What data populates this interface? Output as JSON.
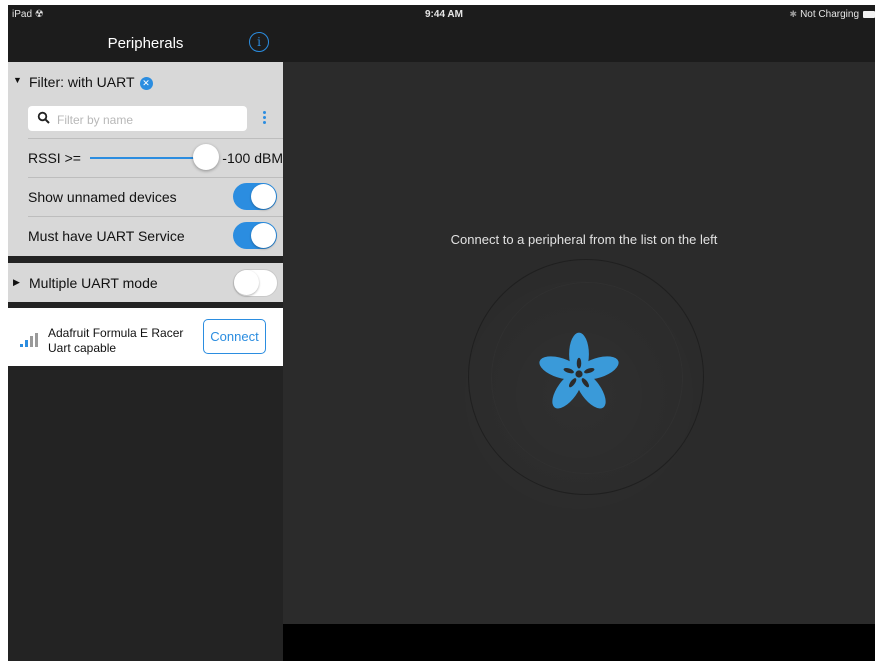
{
  "status_bar": {
    "device": "iPad",
    "time": "9:44 AM",
    "charging": "Not Charging"
  },
  "sidebar": {
    "title": "Peripherals",
    "filter": {
      "title": "Filter: with UART",
      "search_placeholder": "Filter by name",
      "search_value": "",
      "rssi_label": "RSSI >=",
      "rssi_value": "-100 dBM",
      "rssi_level": 1.0,
      "show_unnamed_label": "Show unnamed devices",
      "show_unnamed_on": true,
      "must_have_uart_label": "Must have UART Service",
      "must_have_uart_on": true
    },
    "multiple_uart": {
      "label": "Multiple UART mode",
      "on": false
    },
    "devices": [
      {
        "name": "Adafruit Formula E Racer",
        "subtitle": "Uart capable",
        "action": "Connect"
      }
    ]
  },
  "detail": {
    "message": "Connect to a peripheral from the list on the left"
  },
  "colors": {
    "accent": "#2b8de0",
    "background": "#2b2b2b",
    "panel": "#d8d8d8"
  }
}
